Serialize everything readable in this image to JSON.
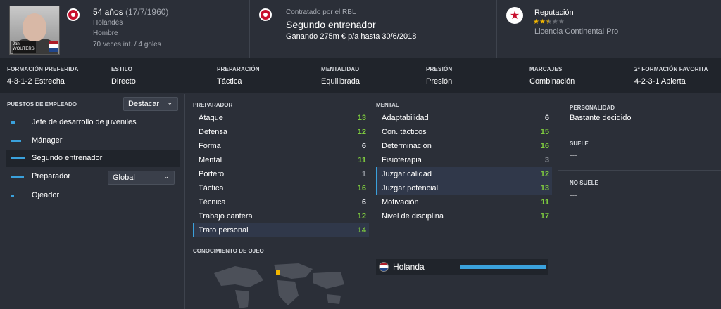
{
  "header": {
    "photo_name": "WOUTERS",
    "photo_first": "Jan",
    "age_line": "54 años",
    "birth": "(17/7/1960)",
    "nationality": "Holandés",
    "gender": "Hombre",
    "caps": "70 veces int. / 4 goles",
    "contract_label": "Contratado por el RBL",
    "role": "Segundo entrenador",
    "contract_detail": "Ganando 275m € p/a hasta 30/6/2018",
    "reputation_label": "Reputación",
    "reputation_stars": 2.5,
    "reputation_max": 5,
    "licence": "Licencia Continental Pro"
  },
  "tactics": [
    {
      "header": "FORMACIÓN PREFERIDA",
      "value": "4-3-1-2 Estrecha"
    },
    {
      "header": "ESTILO",
      "value": "Directo"
    },
    {
      "header": "PREPARACIÓN",
      "value": "Táctica"
    },
    {
      "header": "MENTALIDAD",
      "value": "Equilibrada"
    },
    {
      "header": "PRESIÓN",
      "value": "Presión"
    },
    {
      "header": "MARCAJES",
      "value": "Combinación"
    },
    {
      "header": "2ª FORMACIÓN FAVORITA",
      "value": "4-2-3-1 Abierta"
    }
  ],
  "positions": {
    "title": "PUESTOS DE EMPLEADO",
    "filter": "Destacar",
    "roles": [
      {
        "label": "Jefe de desarrollo de juveniles",
        "suitability": 0.25
      },
      {
        "label": "Mánager",
        "suitability": 0.65
      },
      {
        "label": "Segundo entrenador",
        "suitability": 1.0
      },
      {
        "label": "Preparador",
        "suitability": 0.9,
        "dropdown": "Global"
      },
      {
        "label": "Ojeador",
        "suitability": 0.15
      }
    ]
  },
  "preparador": {
    "title": "PREPARADOR",
    "attributes": [
      {
        "name": "Ataque",
        "value": "13"
      },
      {
        "name": "Defensa",
        "value": "12"
      },
      {
        "name": "Forma",
        "value": "6"
      },
      {
        "name": "Mental",
        "value": "11"
      },
      {
        "name": "Portero",
        "value": "1"
      },
      {
        "name": "Táctica",
        "value": "16"
      },
      {
        "name": "Técnica",
        "value": "6"
      },
      {
        "name": "Trabajo cantera",
        "value": "12"
      },
      {
        "name": "Trato personal",
        "value": "14"
      }
    ]
  },
  "mental": {
    "title": "MENTAL",
    "attributes": [
      {
        "name": "Adaptabilidad",
        "value": "6"
      },
      {
        "name": "Con. tácticos",
        "value": "15"
      },
      {
        "name": "Determinación",
        "value": "16"
      },
      {
        "name": "Fisioterapia",
        "value": "3"
      },
      {
        "name": "Juzgar calidad",
        "value": "12"
      },
      {
        "name": "Juzgar potencial",
        "value": "13"
      },
      {
        "name": "Motivación",
        "value": "11"
      },
      {
        "name": "Nivel de disciplina",
        "value": "17"
      }
    ]
  },
  "scouting": {
    "title": "CONOCIMIENTO DE OJEO",
    "nation": "Holanda",
    "knowledge": 1.0
  },
  "personality": {
    "title": "PERSONALIDAD",
    "value": "Bastante decidido",
    "suele_title": "SUELE",
    "suele_value": "---",
    "no_suele_title": "NO SUELE",
    "no_suele_value": "---"
  },
  "colors": {
    "accent": "#3aa1dc",
    "good": "#7ecb3f",
    "club": "#c8102e"
  }
}
